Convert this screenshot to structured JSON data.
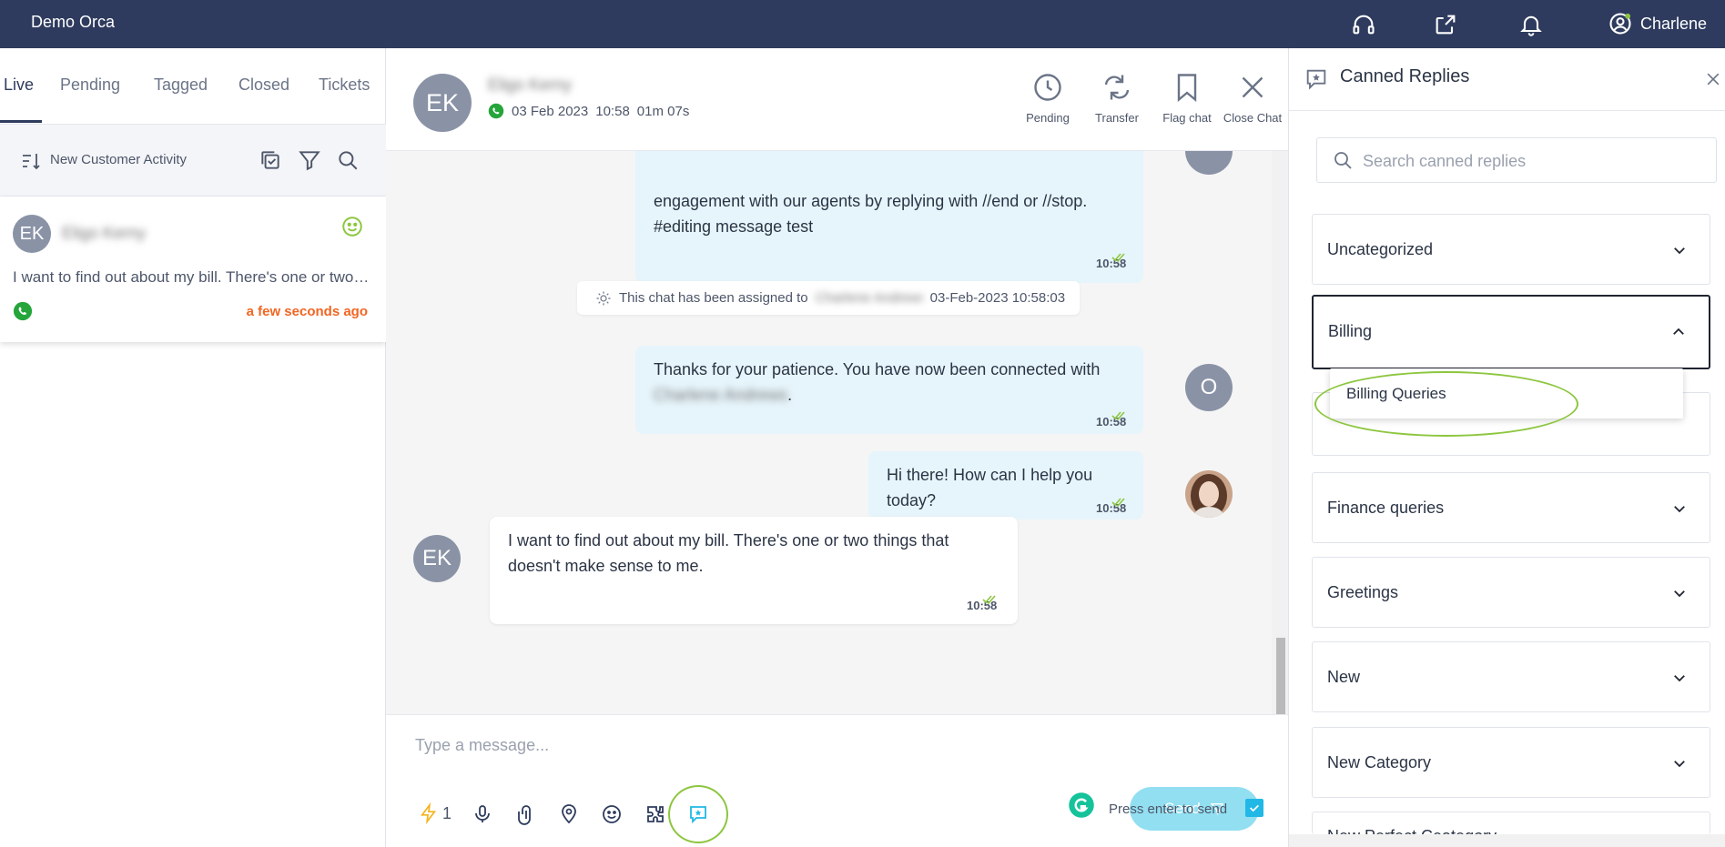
{
  "app": {
    "title": "Demo Orca",
    "user_name": "Charlene"
  },
  "inbox_tabs": [
    "Live",
    "Pending",
    "Tagged",
    "Closed",
    "Tickets"
  ],
  "inbox_toolbar": {
    "sort_label": "New Customer Activity"
  },
  "conversation": {
    "initials": "EK",
    "name": "Eligo Kerny",
    "preview": "I want to find out about my bill. There's one or two things that doesn't make sense to me.",
    "time": "a few seconds ago"
  },
  "chat_header": {
    "initials": "EK",
    "name": "Eligo Kerny",
    "date": "03 Feb 2023",
    "time": "10:58",
    "duration": "01m 07s",
    "actions": [
      "Pending",
      "Transfer",
      "Flag chat",
      "Close Chat"
    ]
  },
  "messages": [
    {
      "lines": [
        "engagement with our agents by replying with //end or //stop.",
        "#editing message test"
      ],
      "time": "10:58"
    },
    {
      "system_prefix": "This chat has been assigned to",
      "system_agent": "Charlene Andrews",
      "system_stamp": "03-Feb-2023 10:58:03"
    },
    {
      "line1": "Thanks for your patience. You have now been connected with",
      "agent": "Charlene Andrews",
      "suffix": ".",
      "time": "10:58",
      "avatar": "O"
    },
    {
      "text": "Hi there! How can I help you today?",
      "time": "10:58"
    },
    {
      "lines": [
        "I want to find out about my bill. There's one or two things that",
        "doesn't make sense to me."
      ],
      "time": "10:58",
      "avatar": "EK"
    }
  ],
  "composer": {
    "placeholder": "Type a message...",
    "send_label": "Send",
    "quick_count": "1",
    "press_enter_label": "Press enter to send"
  },
  "canned": {
    "title": "Canned Replies",
    "search_placeholder": "Search canned replies",
    "categories": [
      "Uncategorized",
      "Billing",
      "Finance queries",
      "Greetings",
      "New",
      "New Category",
      "New Perfect Ceategory"
    ],
    "open_item": "Billing Queries"
  },
  "colors": {
    "topbar": "#2e3b5e",
    "accent": "#21b8e6",
    "highlight": "#8dc63f",
    "time_orange": "#f26522",
    "whatsapp": "#25a53a"
  }
}
